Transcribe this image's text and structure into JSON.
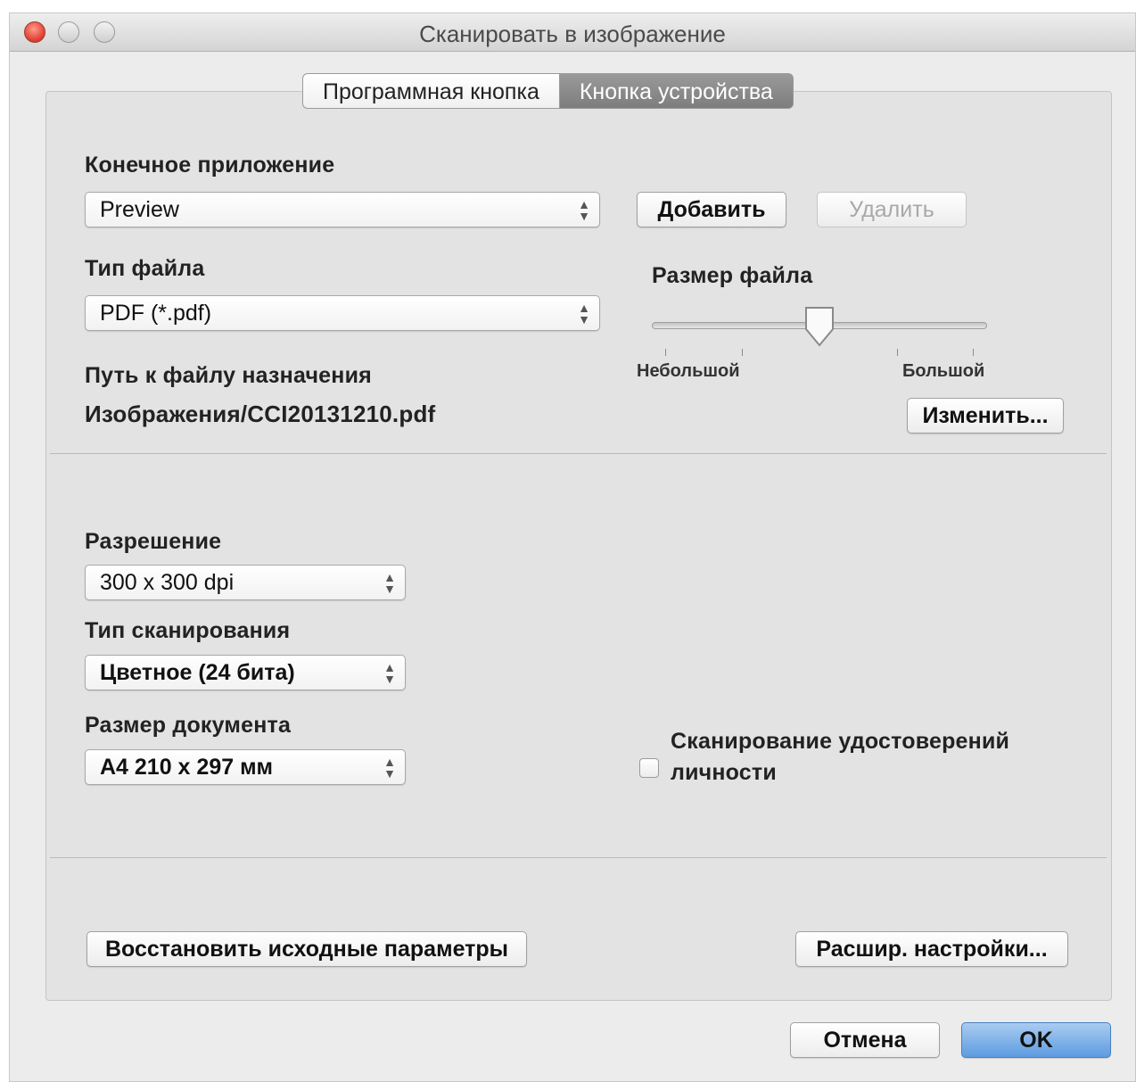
{
  "window": {
    "title": "Сканировать в изображение"
  },
  "tabs": [
    {
      "label": "Программная кнопка",
      "active": true
    },
    {
      "label": "Кнопка устройства",
      "active": false
    }
  ],
  "target_app": {
    "label": "Конечное приложение",
    "value": "Preview",
    "add_label": "Добавить",
    "delete_label": "Удалить"
  },
  "file_type": {
    "label": "Тип файла",
    "value": "PDF (*.pdf)"
  },
  "file_size": {
    "label": "Размер файла",
    "min_label": "Небольшой",
    "max_label": "Большой",
    "level": 0.5
  },
  "destination": {
    "label": "Путь к файлу назначения",
    "value": "Изображения/CCI20131210.pdf",
    "change_label": "Изменить..."
  },
  "resolution": {
    "label": "Разрешение",
    "value": "300 x 300  dpi"
  },
  "scan_type": {
    "label": "Тип сканирования",
    "value": "Цветное (24 бита)"
  },
  "document_size": {
    "label": "Размер документа",
    "value": "A4 210 x 297 мм"
  },
  "id_scan": {
    "label_line1": "Сканирование удостоверений",
    "label_line2": "личности",
    "checked": false
  },
  "footer": {
    "restore_label": "Восстановить исходные параметры",
    "advanced_label": "Расшир. настройки...",
    "cancel_label": "Отмена",
    "ok_label": "OK"
  }
}
